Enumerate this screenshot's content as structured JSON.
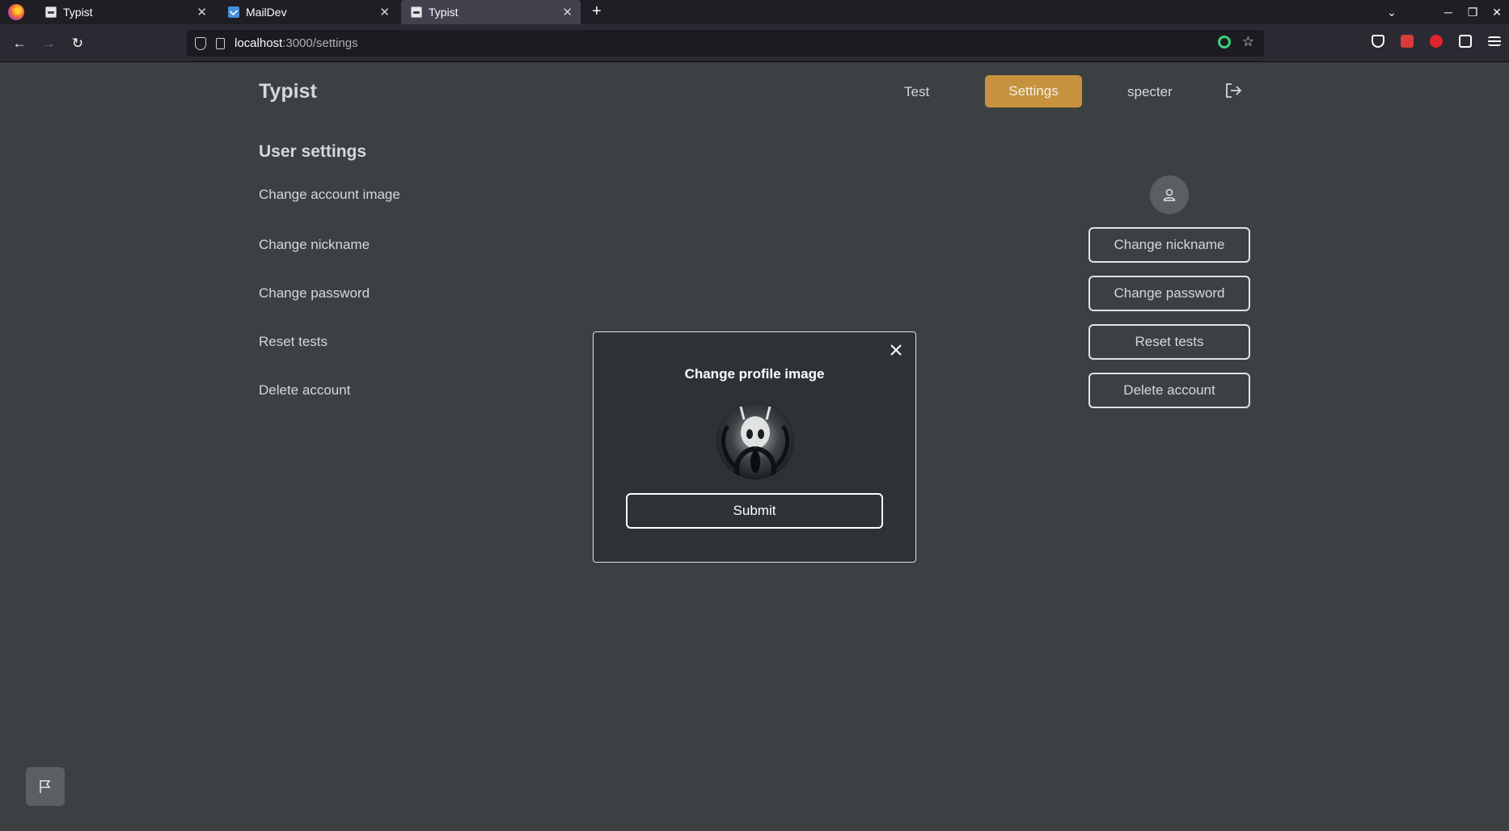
{
  "browser": {
    "tabs": [
      {
        "title": "Typist",
        "icon": "typist-favicon",
        "active": false
      },
      {
        "title": "MailDev",
        "icon": "mail-favicon",
        "active": false
      },
      {
        "title": "Typist",
        "icon": "typist-favicon",
        "active": true
      }
    ],
    "url_host": "localhost",
    "url_path": ":3000/settings"
  },
  "app": {
    "brand": "Typist",
    "nav": {
      "test": "Test",
      "settings": "Settings",
      "user": "specter"
    },
    "accent_color": "#c6923e"
  },
  "settings": {
    "title": "User settings",
    "rows": [
      {
        "label": "Change account image"
      },
      {
        "label": "Change nickname",
        "button": "Change nickname"
      },
      {
        "label": "Change password",
        "button": "Change password"
      },
      {
        "label": "Reset tests",
        "button": "Reset tests"
      },
      {
        "label": "Delete account",
        "button": "Delete account"
      }
    ]
  },
  "modal": {
    "title": "Change profile image",
    "submit": "Submit"
  }
}
